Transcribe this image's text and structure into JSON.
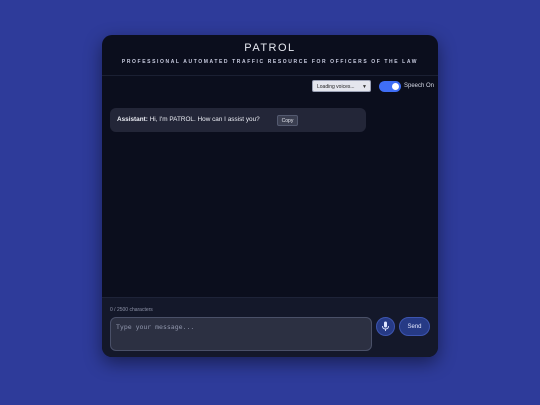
{
  "header": {
    "title": "PATROL",
    "subtitle": "PROFESSIONAL AUTOMATED TRAFFIC RESOURCE FOR OFFICERS OF THE LAW"
  },
  "controls": {
    "voice_select_value": "Loading voices...",
    "speech_toggle_on": true,
    "speech_label": "Speech On"
  },
  "chat": {
    "messages": [
      {
        "speaker": "Assistant:",
        "text": "Hi, I'm PATROL. How can I assist you?",
        "copy_label": "Copy"
      }
    ]
  },
  "footer": {
    "char_count": "0 / 2500 characters",
    "input_placeholder": "Type your message...",
    "send_label": "Send"
  },
  "colors": {
    "page_background": "#2e3b9a",
    "panel_background": "#0b0e1d",
    "accent": "#3f6ef5",
    "button": "#263a85"
  },
  "icons": {
    "mic": "microphone-icon",
    "select": "chevron-down-icon"
  }
}
